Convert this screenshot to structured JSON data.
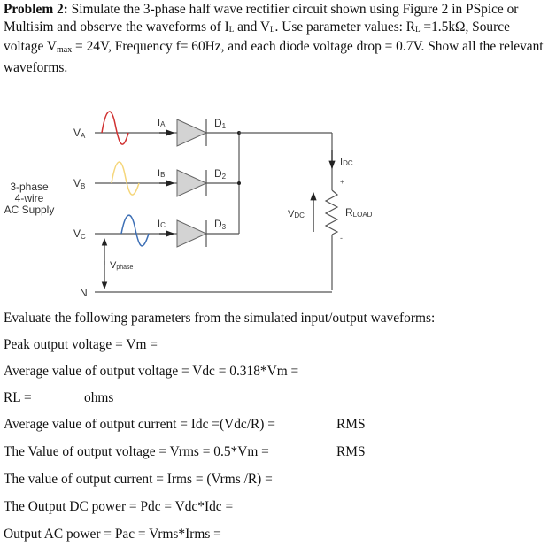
{
  "problem": {
    "label": "Problem 2:",
    "text_1": " Simulate the 3-phase half wave rectifier circuit shown using Figure 2 in PSpice or Multisim and observe the waveforms of I",
    "sub_L1": "L",
    "text_2": " and V",
    "sub_L2": "L",
    "text_3": ". Use parameter values: R",
    "sub_L3": "L",
    "text_4": " =1.5kΩ, Source voltage V",
    "sub_max": "max",
    "text_5": " = 24V, Frequency f= 60Hz, and each diode voltage drop = 0.7V. Show all the relevant waveforms."
  },
  "figure": {
    "supply_label_lines": [
      "3-phase",
      "4-wire",
      "AC Supply"
    ],
    "phases": [
      {
        "name": "V",
        "sub": "A",
        "current": "I",
        "current_sub": "A",
        "diode": "D",
        "diode_sub": "1",
        "wave_color": "#d03030"
      },
      {
        "name": "V",
        "sub": "B",
        "current": "I",
        "current_sub": "B",
        "diode": "D",
        "diode_sub": "2",
        "wave_color": "#f5d67a"
      },
      {
        "name": "V",
        "sub": "C",
        "current": "I",
        "current_sub": "C",
        "diode": "D",
        "diode_sub": "3",
        "wave_color": "#3d6fb5"
      }
    ],
    "neutral": "N",
    "vphase": "V",
    "vphase_sub": "phase",
    "idc": "I",
    "idc_sub": "DC",
    "vdc": "V",
    "vdc_sub": "DC",
    "rload": "R",
    "rload_sub": "LOAD",
    "plus": "+",
    "minus": "-"
  },
  "evaluate": {
    "heading": "Evaluate the following parameters from the simulated input/output waveforms:",
    "lines": [
      "Peak output voltage = Vm =",
      "Average value of output voltage = Vdc = 0.318*Vm =",
      "RL =",
      "Average value of output current = Idc =(Vdc/R) =",
      "The Value of output voltage = Vrms = 0.5*Vm =",
      "The value of output current = Irms = (Vrms /R) =",
      "The Output DC power = Pdc = Vdc*Idc =",
      "Output AC power = Pac = Vrms*Irms ="
    ],
    "ohms_label": "ohms",
    "rms_label_1": "RMS",
    "rms_label_2": "RMS"
  }
}
